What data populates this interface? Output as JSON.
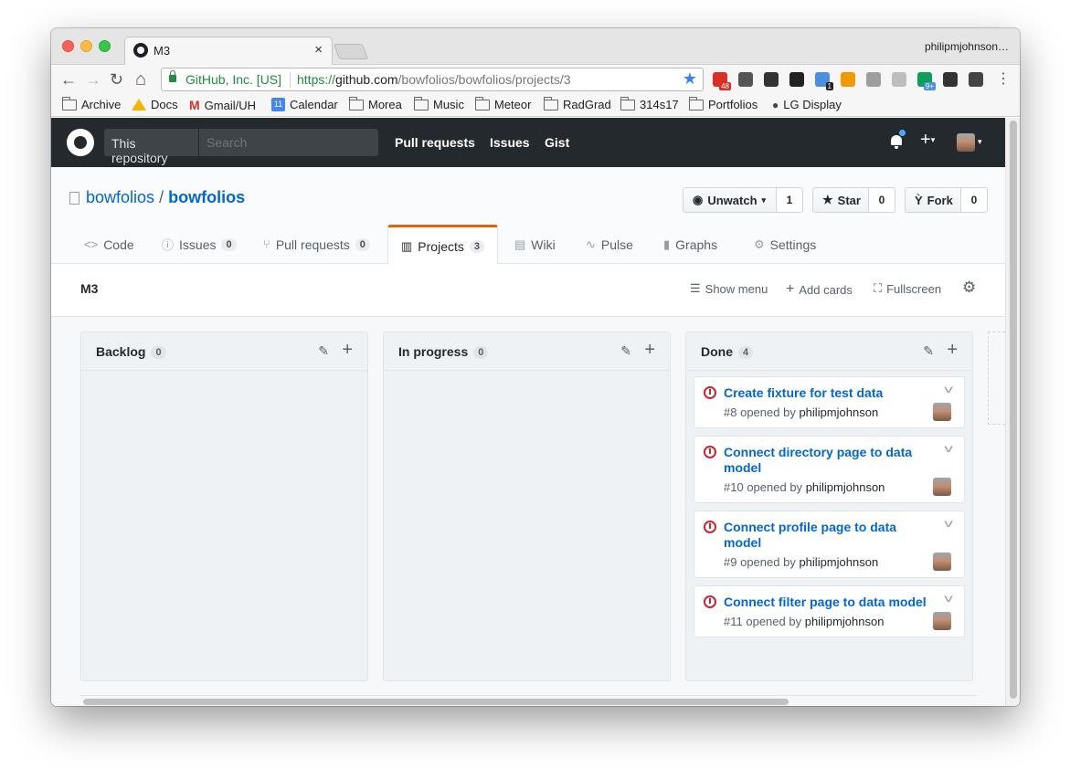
{
  "browser": {
    "tab_title": "M3",
    "tab_close": "×",
    "profile_name": "philipmjohnson…",
    "ev_label": "GitHub, Inc. [US]",
    "url_prefix": "https://",
    "url_host": "github.com",
    "url_path": "/bowfolios/bowfolios/projects/3",
    "nav_back": "←",
    "nav_forward": "→",
    "nav_reload": "↻",
    "nav_home": "⌂",
    "bookmark_star": "★",
    "more": "⋮",
    "extensions": [
      {
        "icon": "calendar-badge-ext-icon",
        "color": "#d93025",
        "badge": "48"
      },
      {
        "icon": "history-ext-icon",
        "color": "#555555",
        "badge": ""
      },
      {
        "icon": "info-ext-icon",
        "color": "#333333",
        "badge": ""
      },
      {
        "icon": "jb-ext-icon",
        "color": "#222222",
        "badge": ""
      },
      {
        "icon": "person-ext-icon",
        "color": "#4a90e2",
        "badge": "1"
      },
      {
        "icon": "chart-ext-icon",
        "color": "#f29900",
        "badge": ""
      },
      {
        "icon": "gauge-ext-icon",
        "color": "#9e9e9e",
        "badge": ""
      },
      {
        "icon": "cloud-ext-icon",
        "color": "#bdbdbd",
        "badge": ""
      },
      {
        "icon": "hangouts-ext-icon",
        "color": "#0f9d58",
        "badge": "9+"
      },
      {
        "icon": "eyedropper-ext-icon",
        "color": "#333333",
        "badge": ""
      },
      {
        "icon": "colorwheel-ext-icon",
        "color": "#444444",
        "badge": ""
      }
    ]
  },
  "bookmarks": [
    {
      "label": "Archive",
      "icon": "folder-icon"
    },
    {
      "label": "Docs",
      "icon": "drive-icon"
    },
    {
      "label": "Gmail/UH",
      "icon": "gmail-icon"
    },
    {
      "label": "Calendar",
      "icon": "calendar-icon"
    },
    {
      "label": "Morea",
      "icon": "folder-icon"
    },
    {
      "label": "Music",
      "icon": "folder-icon"
    },
    {
      "label": "Meteor",
      "icon": "folder-icon"
    },
    {
      "label": "RadGrad",
      "icon": "folder-icon"
    },
    {
      "label": "314s17",
      "icon": "folder-icon"
    },
    {
      "label": "Portfolios",
      "icon": "folder-icon"
    },
    {
      "label": "LG Display",
      "icon": "apple-icon"
    }
  ],
  "header": {
    "scope": "This repository",
    "search_placeholder": "Search",
    "links": [
      "Pull requests",
      "Issues",
      "Gist"
    ],
    "plus": "+"
  },
  "repo": {
    "owner": "bowfolios",
    "separator": "/",
    "name": "bowfolios",
    "watch": {
      "label": "Unwatch",
      "count": "1"
    },
    "star": {
      "label": "Star",
      "count": "0"
    },
    "fork": {
      "label": "Fork",
      "count": "0"
    }
  },
  "tabs": [
    {
      "label": "Code",
      "icon": "code-icon",
      "count": ""
    },
    {
      "label": "Issues",
      "icon": "issue-opened-icon",
      "count": "0"
    },
    {
      "label": "Pull requests",
      "icon": "git-pull-request-icon",
      "count": "0"
    },
    {
      "label": "Projects",
      "icon": "project-icon",
      "count": "3",
      "selected": true
    },
    {
      "label": "Wiki",
      "icon": "book-icon",
      "count": ""
    },
    {
      "label": "Pulse",
      "icon": "pulse-icon",
      "count": ""
    },
    {
      "label": "Graphs",
      "icon": "graph-icon",
      "count": ""
    },
    {
      "label": "Settings",
      "icon": "gear-icon",
      "count": ""
    }
  ],
  "project": {
    "name": "M3",
    "show_menu": "Show menu",
    "add_cards": "Add cards",
    "fullscreen": "Fullscreen"
  },
  "columns": [
    {
      "title": "Backlog",
      "count": "0",
      "cards": []
    },
    {
      "title": "In progress",
      "count": "0",
      "cards": []
    },
    {
      "title": "Done",
      "count": "4",
      "cards": [
        {
          "title": "Create fixture for test data",
          "number": "#8",
          "opened_by": "opened by",
          "user": "philipmjohnson"
        },
        {
          "title": "Connect directory page to data model",
          "number": "#10",
          "opened_by": "opened by",
          "user": "philipmjohnson"
        },
        {
          "title": "Connect profile page to data model",
          "number": "#9",
          "opened_by": "opened by",
          "user": "philipmjohnson"
        },
        {
          "title": "Connect filter page to data model",
          "number": "#11",
          "opened_by": "opened by",
          "user": "philipmjohnson"
        }
      ]
    }
  ],
  "colors": {
    "header_bg": "#24292e",
    "link_blue": "#0366d6",
    "tab_accent": "#e36209",
    "issue_closed_red": "#cb2431"
  }
}
